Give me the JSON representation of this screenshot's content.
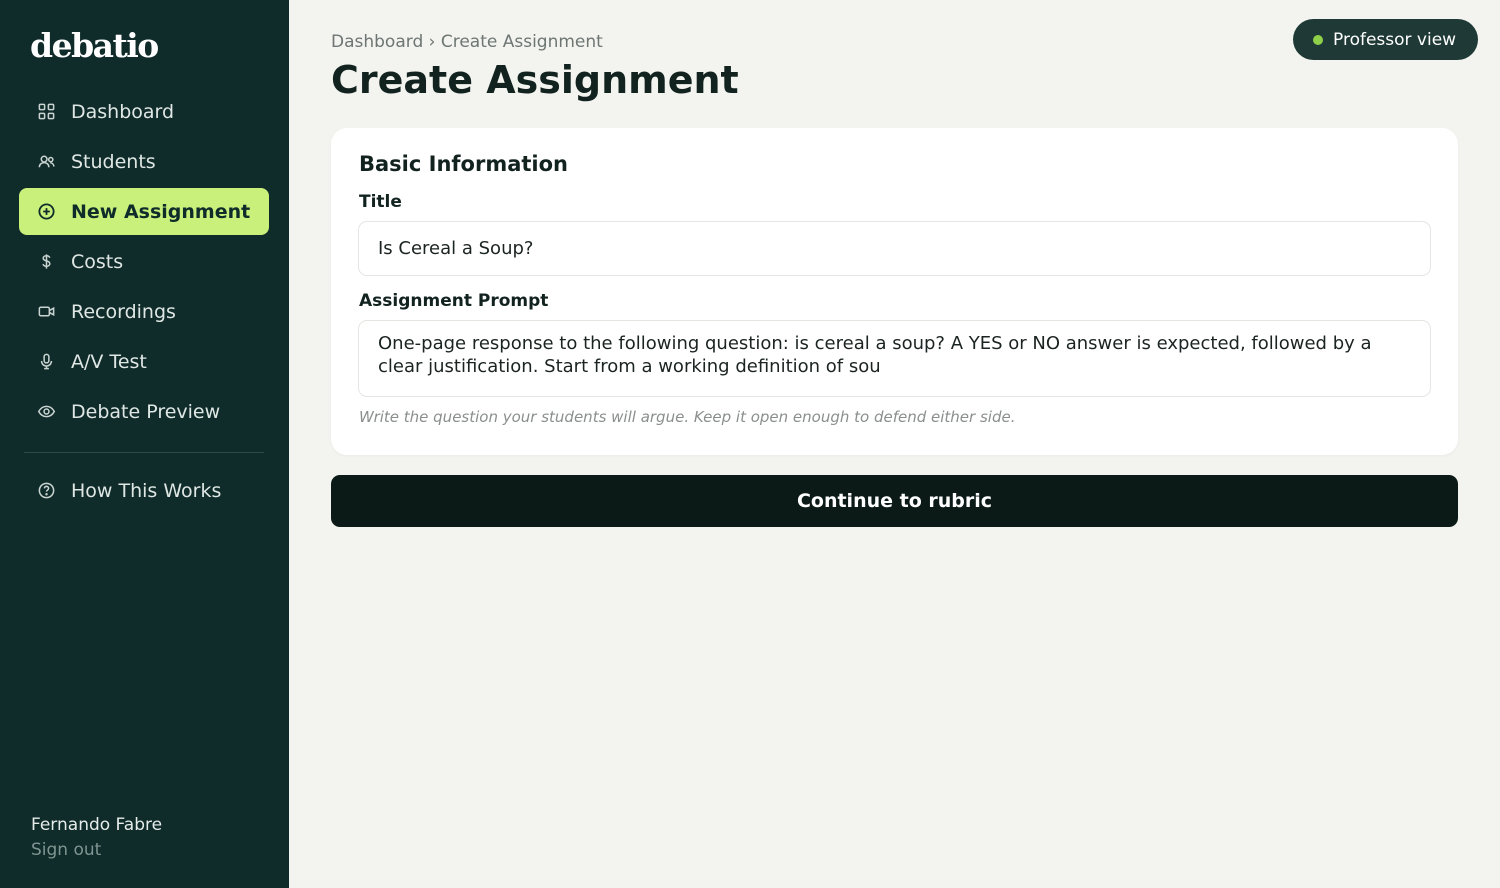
{
  "app": {
    "logo": "debatio"
  },
  "sidebar": {
    "items": [
      {
        "label": "Dashboard",
        "icon": "grid-icon"
      },
      {
        "label": "Students",
        "icon": "users-icon"
      },
      {
        "label": "New Assignment",
        "icon": "plus-circle-icon",
        "active": true
      },
      {
        "label": "Costs",
        "icon": "dollar-icon"
      },
      {
        "label": "Recordings",
        "icon": "video-icon"
      },
      {
        "label": "A/V Test",
        "icon": "microphone-icon"
      },
      {
        "label": "Debate Preview",
        "icon": "eye-icon"
      }
    ],
    "secondary": [
      {
        "label": "How This Works",
        "icon": "help-circle-icon"
      }
    ],
    "user": {
      "name": "Fernando Fabre",
      "sign_out": "Sign out"
    }
  },
  "header": {
    "breadcrumb": "Dashboard › Create Assignment",
    "title": "Create Assignment",
    "view_badge": "Professor view"
  },
  "form": {
    "section_title": "Basic Information",
    "title_label": "Title",
    "title_value": "Is Cereal a Soup?",
    "prompt_label": "Assignment Prompt",
    "prompt_value": "One-page response to the following question: is cereal a soup? A YES or NO answer is expected, followed by a clear justification. Start from a working definition of sou",
    "hint": "Write the question your students will argue. Keep it open enough to defend either side.",
    "continue_label": "Continue to rubric"
  },
  "colors": {
    "sidebar_bg": "#0f2b2a",
    "accent": "#c8f07b",
    "page_bg": "#f3f3ef",
    "button_bg": "#0b1a16",
    "status_dot": "#8fd04a"
  }
}
